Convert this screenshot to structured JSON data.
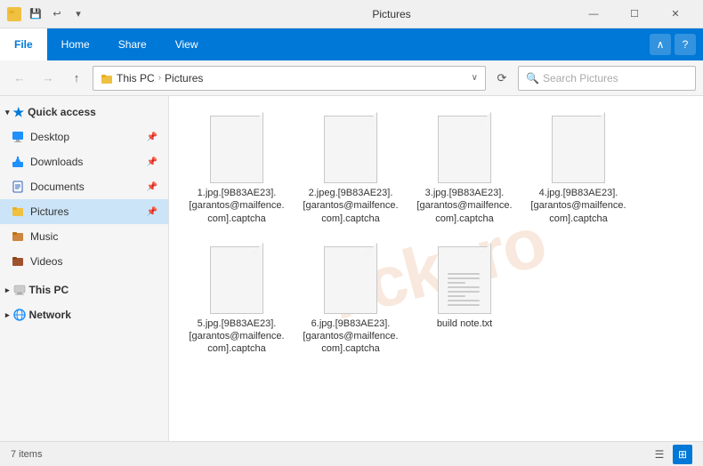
{
  "window": {
    "title": "Pictures",
    "icon": "📁"
  },
  "titlebar": {
    "qat": [
      "💾",
      "↩",
      "▼"
    ],
    "controls": [
      "—",
      "☐",
      "✕"
    ]
  },
  "ribbon": {
    "tabs": [
      {
        "label": "File",
        "active": true
      },
      {
        "label": "Home"
      },
      {
        "label": "Share"
      },
      {
        "label": "View"
      }
    ],
    "collapse_label": "∧",
    "help_label": "?"
  },
  "addressbar": {
    "nav_back": "←",
    "nav_forward": "→",
    "nav_up": "↑",
    "breadcrumb": [
      "This PC",
      "Pictures"
    ],
    "dropdown": "∨",
    "refresh": "⟳",
    "search_placeholder": "Search Pictures"
  },
  "sidebar": {
    "quick_access_label": "Quick access",
    "items": [
      {
        "label": "Desktop",
        "type": "desktop",
        "pinned": true
      },
      {
        "label": "Downloads",
        "type": "download",
        "pinned": true
      },
      {
        "label": "Documents",
        "type": "doc",
        "pinned": true
      },
      {
        "label": "Pictures",
        "type": "pictures",
        "pinned": true,
        "active": true
      },
      {
        "label": "Music",
        "type": "music"
      },
      {
        "label": "Videos",
        "type": "video"
      }
    ],
    "this_pc_label": "This PC",
    "network_label": "Network"
  },
  "files": [
    {
      "name": "1.jpg.[9B83AE23].[garantos@mailfence.com].captcha",
      "type": "blank"
    },
    {
      "name": "2.jpeg.[9B83AE23].[garantos@mailfence.com].captcha",
      "type": "blank"
    },
    {
      "name": "3.jpg.[9B83AE23].[garantos@mailfence.com].captcha",
      "type": "blank"
    },
    {
      "name": "4.jpg.[9B83AE23].[garantos@mailfence.com].captcha",
      "type": "blank"
    },
    {
      "name": "5.jpg.[9B83AE23].[garantos@mailfence.com].captcha",
      "type": "blank"
    },
    {
      "name": "6.jpg.[9B83AE23].[garantos@mailfence.com].captcha",
      "type": "blank"
    },
    {
      "name": "build note.txt",
      "type": "text"
    }
  ],
  "statusbar": {
    "item_count": "7 items",
    "view_list_icon": "☰",
    "view_detail_icon": "▦",
    "view_icon_icon": "⊞"
  },
  "watermark": "fickcro"
}
